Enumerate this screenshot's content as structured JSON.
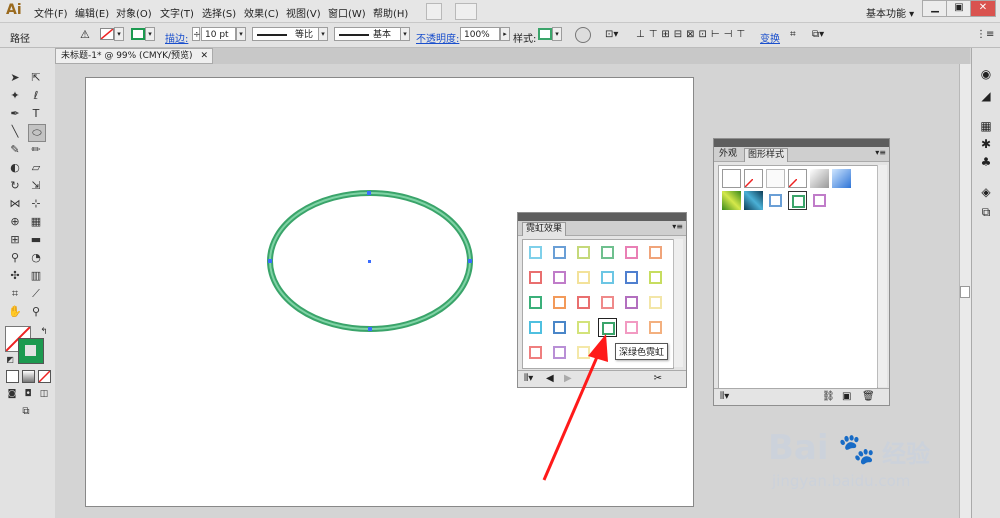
{
  "app": {
    "logo": "Ai",
    "workspace": "基本功能 ▾"
  },
  "menus": [
    "文件(F)",
    "编辑(E)",
    "对象(O)",
    "文字(T)",
    "选择(S)",
    "效果(C)",
    "视图(V)",
    "窗口(W)",
    "帮助(H)"
  ],
  "window_buttons": {
    "minimize": "▁",
    "restore": "▣",
    "close": "✕"
  },
  "control_bar": {
    "object_type": "路径",
    "stroke_label": "描边:",
    "stroke_weight": "10 pt",
    "profile_label": "等比",
    "brush_label": "基本",
    "opacity_label": "不透明度:",
    "opacity_value": "100%",
    "style_label": "样式:",
    "transform_label": "变换"
  },
  "document": {
    "tab_title": "未标题-1* @ 99% (CMYK/预览)"
  },
  "colors": {
    "stroke_green": "#3aa46a",
    "stroke_light": "#7fd3a5",
    "anchor_blue": "#3a6cff"
  },
  "neon_panel": {
    "title": "霓虹效果",
    "tooltip": "深绿色霓虹",
    "swatch_colors": [
      [
        "#7fd0ea",
        "#6a9fd6",
        "#c5d97a",
        "#6fc08e",
        "#e97fb5",
        "#f0a47a"
      ],
      [
        "#e96f6f",
        "#c07cc9",
        "#f3e29a",
        "#6cc6e4",
        "#4f7fcf",
        "#c7dd60"
      ],
      [
        "#3bb07a",
        "#f39a5a",
        "#e96f6f",
        "#ef8a8a",
        "#b36fbf",
        "#f3e6a8"
      ],
      [
        "#4fc0e0",
        "#4a86c8",
        "#d3e37a",
        "#3aa46a",
        "#f29ac2",
        "#f3b07f"
      ],
      [
        "#ef7f7f",
        "#b98fd6",
        "#f4e8a8"
      ]
    ]
  },
  "styles_panel": {
    "tabs": [
      "外观",
      "图形样式"
    ],
    "row1": [
      "default",
      "no-stroke",
      "plain",
      "no-fill",
      "gray-gradient",
      "blue-gradient"
    ],
    "row2_colors": [
      "#6fb22a",
      "#2a6a8a",
      "#6a9fd6",
      "#3aa46a",
      "#c07cc9"
    ]
  },
  "watermark": {
    "brand": "Bai",
    "brand_suffix": "经验",
    "url": "jingyan.baidu.com"
  }
}
